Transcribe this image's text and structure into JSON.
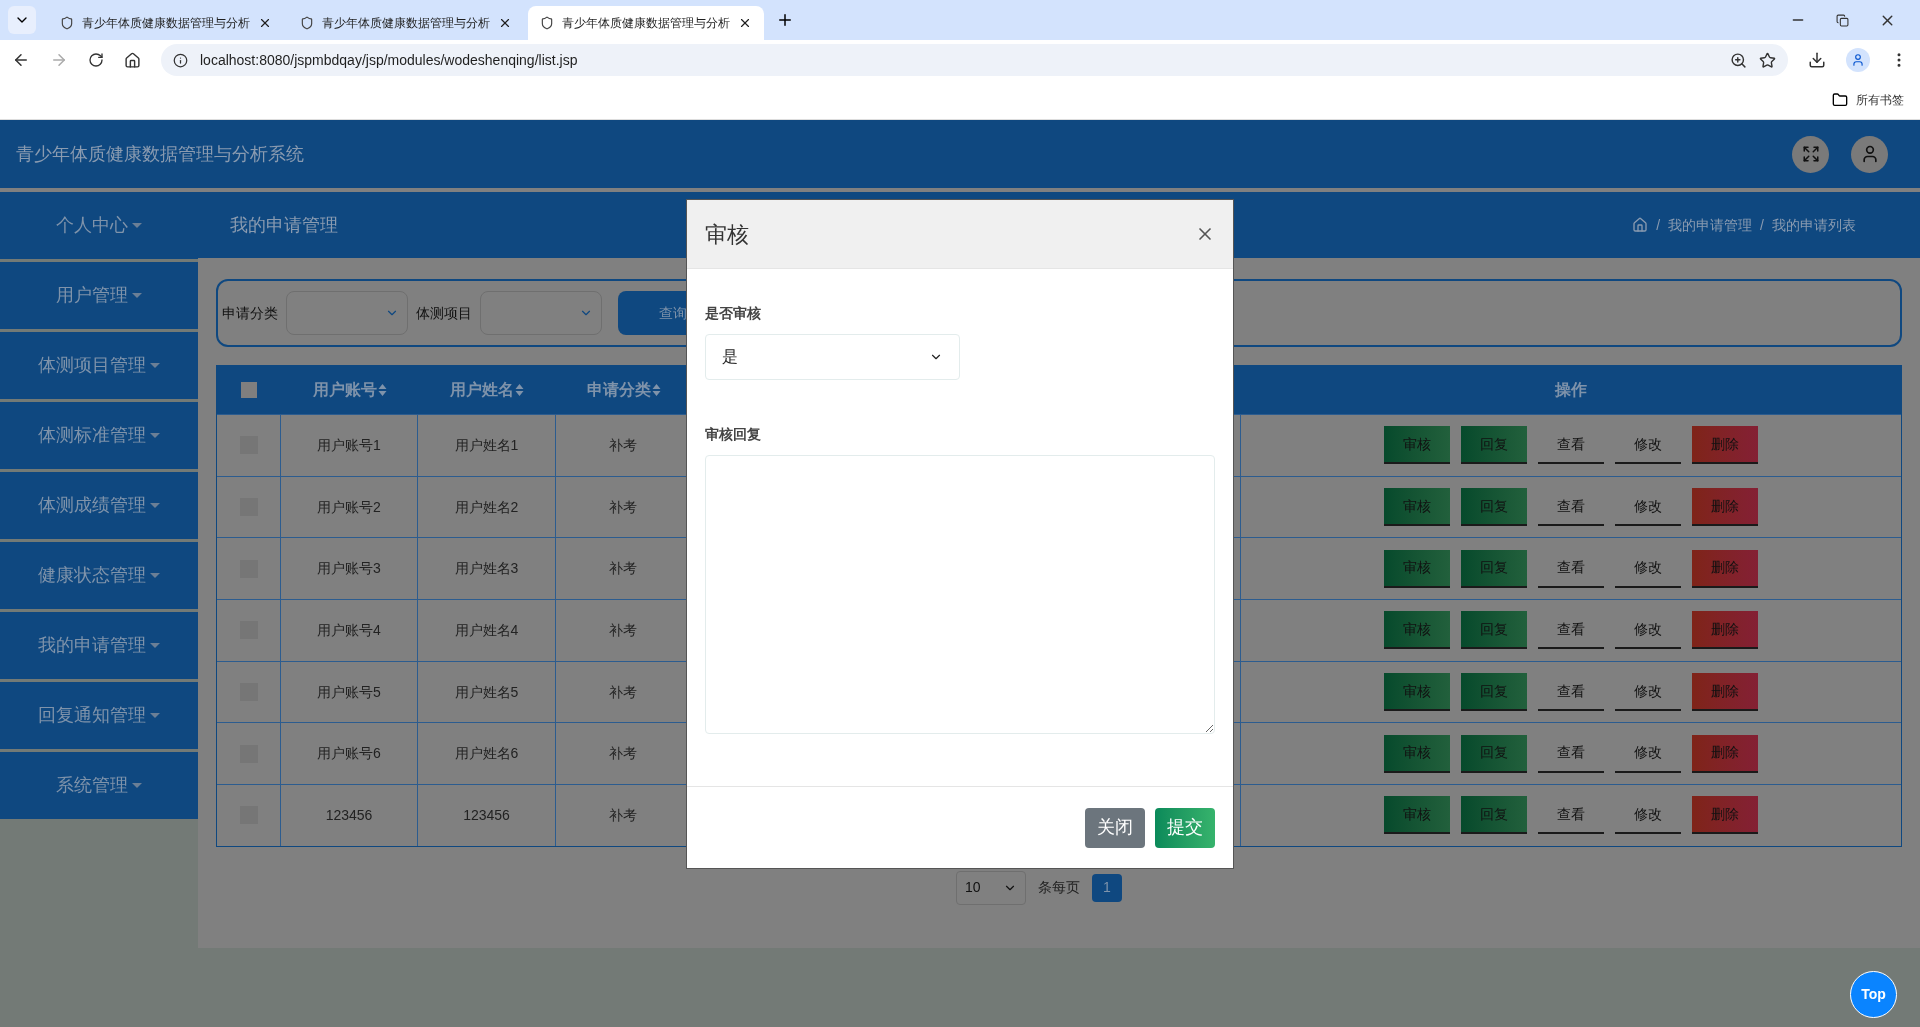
{
  "browser": {
    "tabs": [
      {
        "title": "青少年体质健康数据管理与分析",
        "selected": false
      },
      {
        "title": "青少年体质健康数据管理与分析",
        "selected": false
      },
      {
        "title": "青少年体质健康数据管理与分析",
        "selected": true
      }
    ],
    "address": "localhost:8080/jspmbdqay/jsp/modules/wodeshenqing/list.jsp",
    "bookmarks_label": "所有书签"
  },
  "header": {
    "title": "青少年体质健康数据管理与分析系统"
  },
  "sidebar": {
    "items": [
      {
        "label": "个人中心"
      },
      {
        "label": "用户管理"
      },
      {
        "label": "体测项目管理"
      },
      {
        "label": "体测标准管理"
      },
      {
        "label": "体测成绩管理"
      },
      {
        "label": "健康状态管理"
      },
      {
        "label": "我的申请管理"
      },
      {
        "label": "回复通知管理"
      },
      {
        "label": "系统管理"
      }
    ]
  },
  "page_header": {
    "title": "我的申请管理",
    "breadcrumbs": [
      {
        "separator": "/",
        "label": "我的申请管理"
      },
      {
        "separator": "/",
        "label": "我的申请列表"
      }
    ]
  },
  "search": {
    "fields": [
      {
        "label": "申请分类"
      },
      {
        "label": "体测项目"
      }
    ],
    "button": "查询"
  },
  "table": {
    "header_checked": false,
    "columns": [
      "用户账号",
      "用户姓名",
      "申请分类"
    ],
    "action_column": "操作",
    "rows": [
      {
        "checked": false,
        "cells": [
          "用户账号1",
          "用户姓名1",
          "补考"
        ],
        "actions": [
          {
            "label": "审核",
            "kind": "green"
          },
          {
            "label": "回复",
            "kind": "green"
          },
          {
            "label": "查看",
            "kind": "plain"
          },
          {
            "label": "修改",
            "kind": "plain"
          },
          {
            "label": "删除",
            "kind": "red"
          }
        ]
      },
      {
        "checked": false,
        "cells": [
          "用户账号2",
          "用户姓名2",
          "补考"
        ],
        "actions": [
          {
            "label": "审核",
            "kind": "green"
          },
          {
            "label": "回复",
            "kind": "green"
          },
          {
            "label": "查看",
            "kind": "plain"
          },
          {
            "label": "修改",
            "kind": "plain"
          },
          {
            "label": "删除",
            "kind": "red"
          }
        ]
      },
      {
        "checked": false,
        "cells": [
          "用户账号3",
          "用户姓名3",
          "补考"
        ],
        "actions": [
          {
            "label": "审核",
            "kind": "green"
          },
          {
            "label": "回复",
            "kind": "green"
          },
          {
            "label": "查看",
            "kind": "plain"
          },
          {
            "label": "修改",
            "kind": "plain"
          },
          {
            "label": "删除",
            "kind": "red"
          }
        ]
      },
      {
        "checked": false,
        "cells": [
          "用户账号4",
          "用户姓名4",
          "补考"
        ],
        "actions": [
          {
            "label": "审核",
            "kind": "green"
          },
          {
            "label": "回复",
            "kind": "green"
          },
          {
            "label": "查看",
            "kind": "plain"
          },
          {
            "label": "修改",
            "kind": "plain"
          },
          {
            "label": "删除",
            "kind": "red"
          }
        ]
      },
      {
        "checked": false,
        "cells": [
          "用户账号5",
          "用户姓名5",
          "补考"
        ],
        "actions": [
          {
            "label": "审核",
            "kind": "green"
          },
          {
            "label": "回复",
            "kind": "green"
          },
          {
            "label": "查看",
            "kind": "plain"
          },
          {
            "label": "修改",
            "kind": "plain"
          },
          {
            "label": "删除",
            "kind": "red"
          }
        ]
      },
      {
        "checked": false,
        "cells": [
          "用户账号6",
          "用户姓名6",
          "补考"
        ],
        "actions": [
          {
            "label": "审核",
            "kind": "green"
          },
          {
            "label": "回复",
            "kind": "green"
          },
          {
            "label": "查看",
            "kind": "plain"
          },
          {
            "label": "修改",
            "kind": "plain"
          },
          {
            "label": "删除",
            "kind": "red"
          }
        ]
      },
      {
        "checked": false,
        "cells": [
          "123456",
          "123456",
          "补考"
        ],
        "actions": [
          {
            "label": "审核",
            "kind": "green"
          },
          {
            "label": "回复",
            "kind": "green"
          },
          {
            "label": "查看",
            "kind": "plain"
          },
          {
            "label": "修改",
            "kind": "plain"
          },
          {
            "label": "删除",
            "kind": "red"
          }
        ]
      }
    ]
  },
  "pagination": {
    "page_size": "10",
    "label": "条每页",
    "pages": [
      {
        "label": "1",
        "selected": true
      }
    ]
  },
  "modal": {
    "title": "审核",
    "fields": [
      {
        "kind": "select",
        "label": "是否审核",
        "value": "是"
      },
      {
        "kind": "textarea",
        "label": "审核回复"
      }
    ],
    "buttons": [
      {
        "label": "关闭",
        "kind": "secondary"
      },
      {
        "label": "提交",
        "kind": "primary"
      }
    ]
  },
  "top_button": "Top"
}
